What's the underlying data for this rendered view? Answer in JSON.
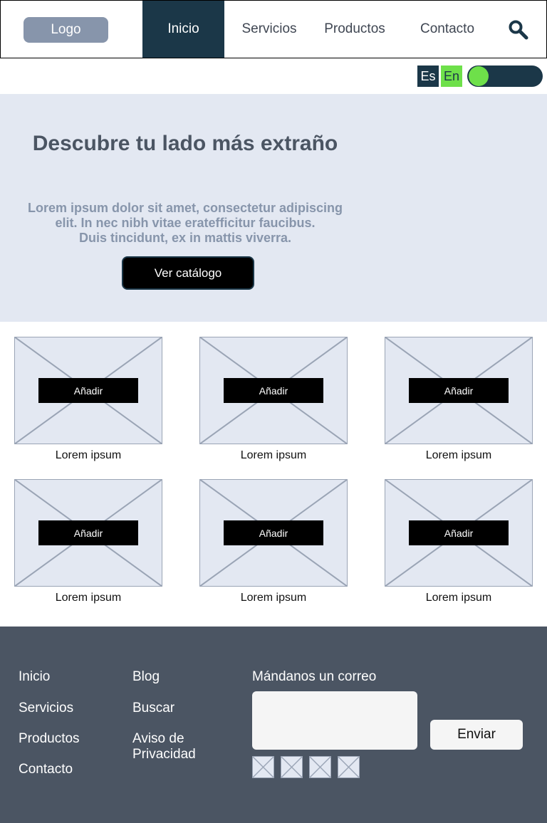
{
  "nav": {
    "logo": "Logo",
    "items": [
      "Inicio",
      "Servicios",
      "Productos",
      "Contacto"
    ],
    "active": "Inicio",
    "search_icon": "search-icon"
  },
  "lang": {
    "es": "Es",
    "en": "En",
    "toggle_on": true
  },
  "hero": {
    "title": "Descubre tu lado más extraño",
    "text_line1": "Lorem ipsum dolor sit amet, consectetur adipiscing",
    "text_line2": "elit. In nec nibh vitae eratefficitur faucibus.",
    "text_line3": "Duis tincidunt, ex in mattis viverra.",
    "button": "Ver catálogo"
  },
  "products": [
    {
      "button": "Añadir",
      "label": "Lorem ipsum"
    },
    {
      "button": "Añadir",
      "label": "Lorem ipsum"
    },
    {
      "button": "Añadir",
      "label": "Lorem ipsum"
    },
    {
      "button": "Añadir",
      "label": "Lorem ipsum"
    },
    {
      "button": "Añadir",
      "label": "Lorem ipsum"
    },
    {
      "button": "Añadir",
      "label": "Lorem ipsum"
    }
  ],
  "footer": {
    "col1": [
      "Inicio",
      "Servicios",
      "Productos",
      "Contacto"
    ],
    "col2": [
      "Blog",
      "Buscar",
      "Aviso de Privacidad"
    ],
    "mail_heading": "Mándanos un correo",
    "send": "Enviar"
  },
  "colors": {
    "primary_dark": "#1b3748",
    "accent_green": "#6ee04a",
    "hero_bg": "#e3e8f2",
    "footer_bg": "#4b5563"
  }
}
